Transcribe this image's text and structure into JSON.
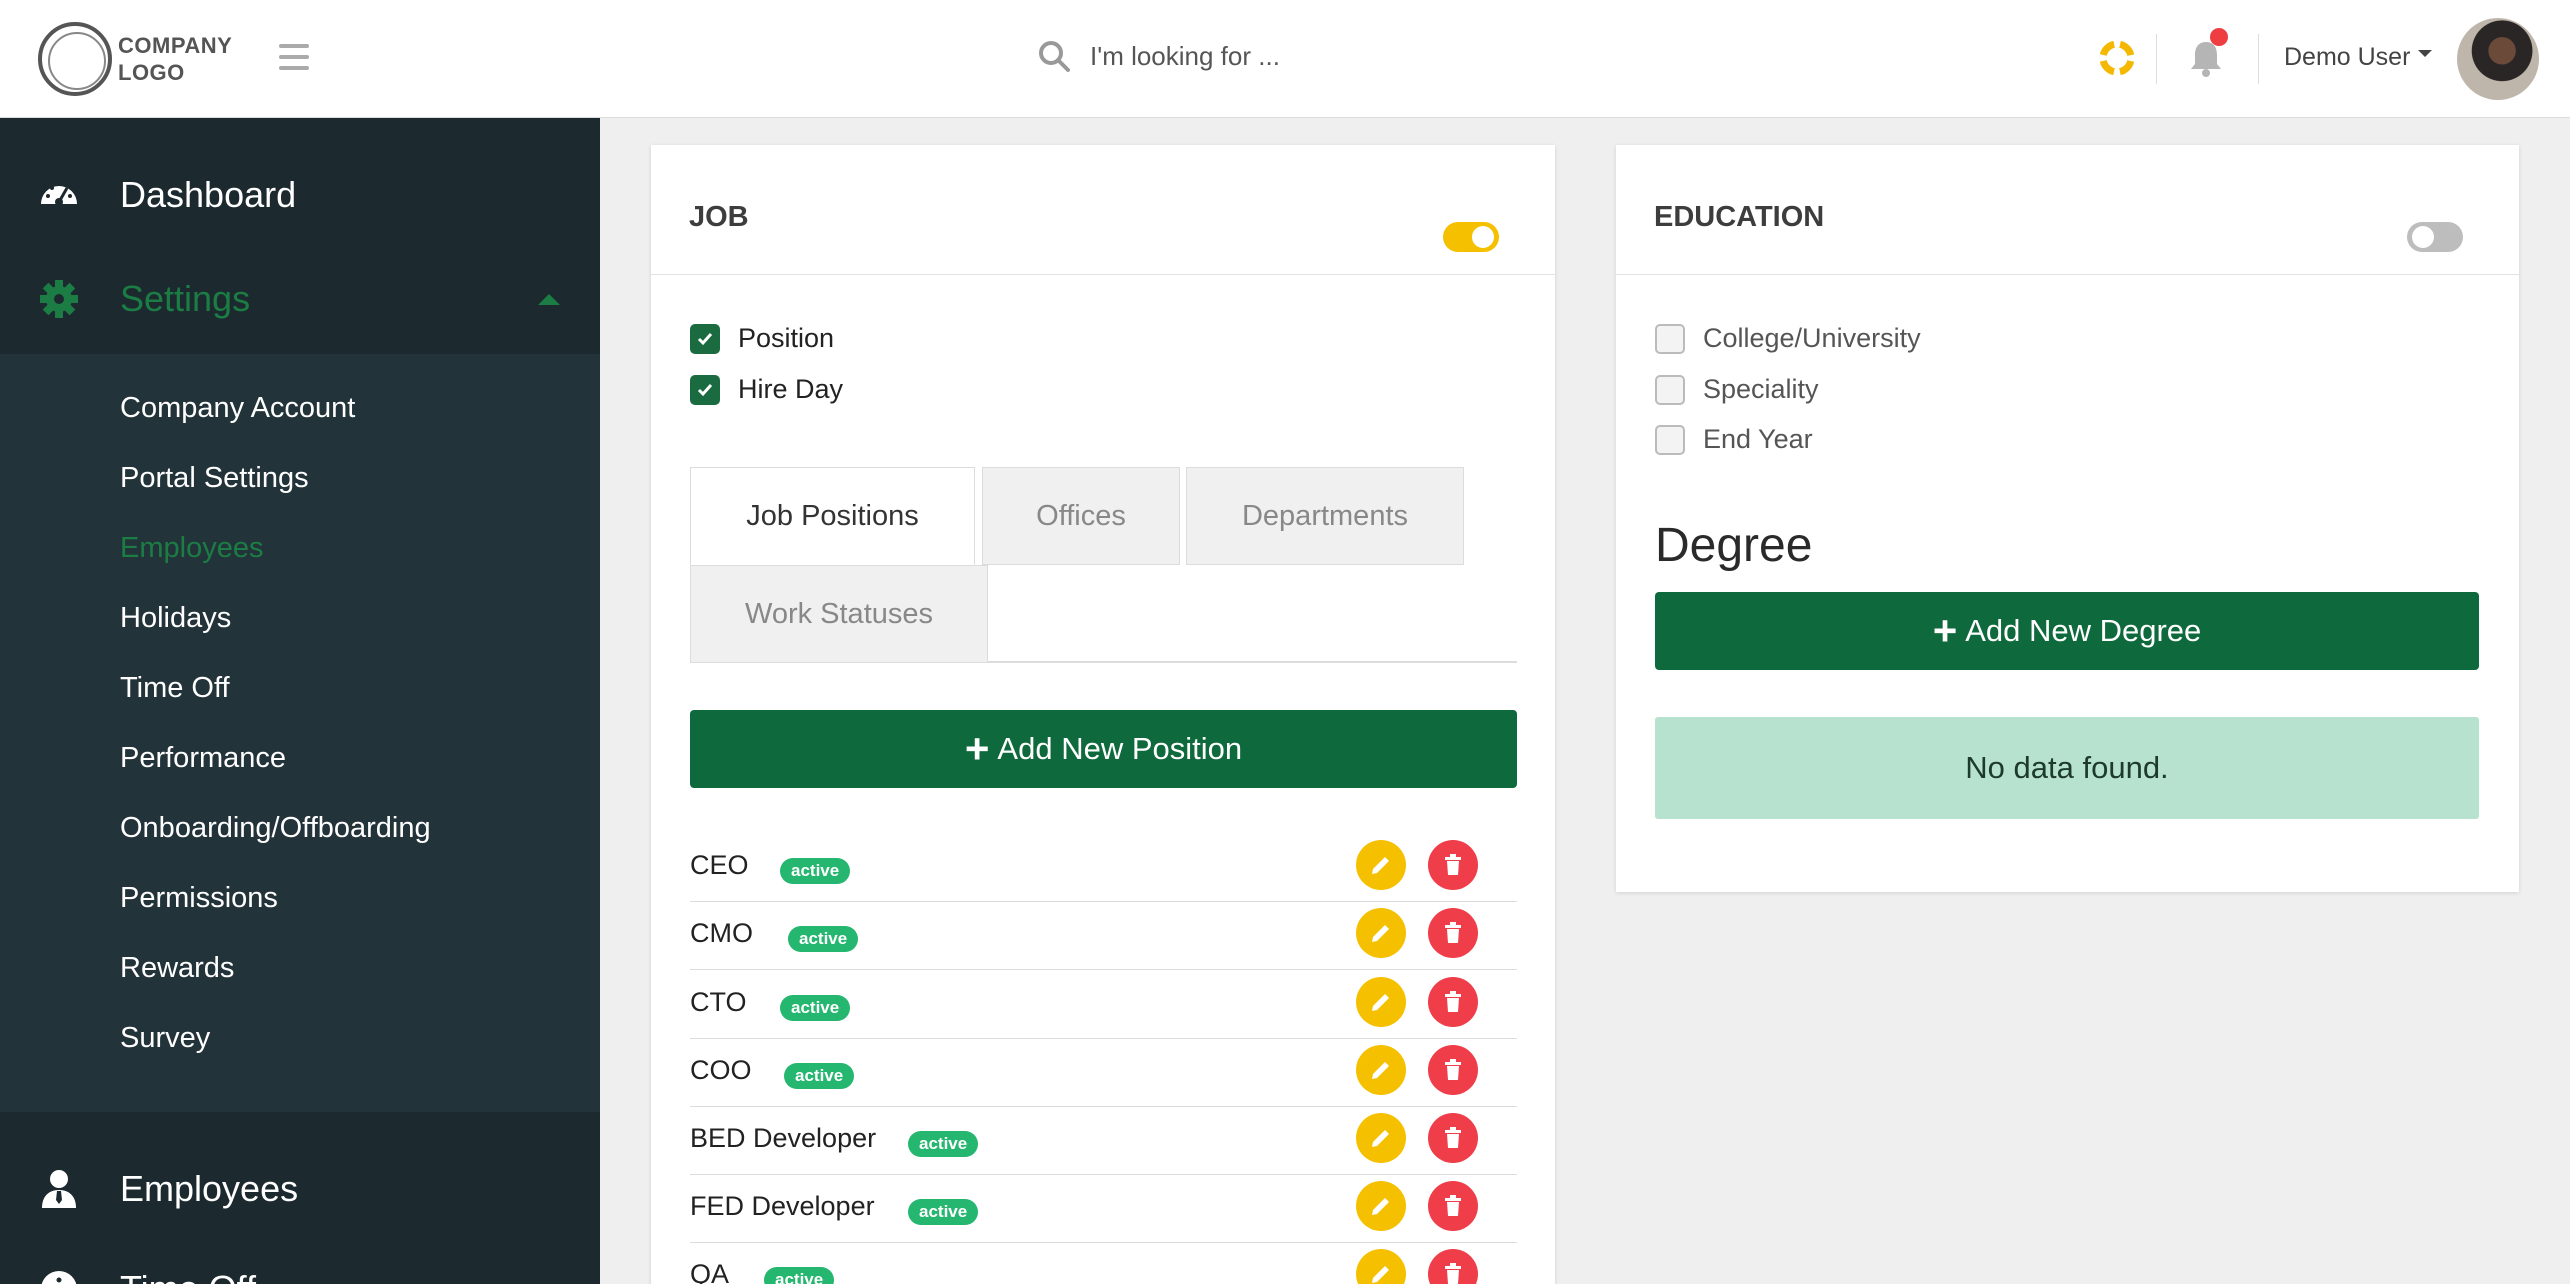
{
  "header": {
    "logo_line1": "COMPANY",
    "logo_line2": "LOGO",
    "search_placeholder": "I'm looking for ...",
    "user_name": "Demo User"
  },
  "sidebar": {
    "dashboard": "Dashboard",
    "settings": "Settings",
    "sub_items": [
      "Company Account",
      "Portal Settings",
      "Employees",
      "Holidays",
      "Time Off",
      "Performance",
      "Onboarding/Offboarding",
      "Permissions",
      "Rewards",
      "Survey"
    ],
    "active_sub_item": "Employees",
    "employees": "Employees",
    "time_off_partial": "Time Off"
  },
  "job_card": {
    "title": "JOB",
    "toggle_on": true,
    "checkboxes": [
      {
        "label": "Position",
        "checked": true
      },
      {
        "label": "Hire Day",
        "checked": true
      }
    ],
    "tabs": [
      "Job Positions",
      "Offices",
      "Departments",
      "Work Statuses"
    ],
    "active_tab": "Job Positions",
    "add_button": "Add New Position",
    "positions": [
      {
        "name": "CEO",
        "status": "active"
      },
      {
        "name": "CMO",
        "status": "active"
      },
      {
        "name": "CTO",
        "status": "active"
      },
      {
        "name": "COO",
        "status": "active"
      },
      {
        "name": "BED Developer",
        "status": "active"
      },
      {
        "name": "FED Developer",
        "status": "active"
      },
      {
        "name": "QA",
        "status": "active"
      }
    ]
  },
  "education_card": {
    "title": "EDUCATION",
    "toggle_on": false,
    "checkboxes": [
      {
        "label": "College/University",
        "checked": false
      },
      {
        "label": "Speciality",
        "checked": false
      },
      {
        "label": "End Year",
        "checked": false
      }
    ],
    "degree_heading": "Degree",
    "add_button": "Add New Degree",
    "empty_message": "No data found."
  },
  "colors": {
    "brand_green": "#0e6a3c",
    "sidebar_bg": "#23333a",
    "accent_yellow": "#f5c000",
    "danger_red": "#ef3e4a",
    "badge_green": "#25b66f"
  }
}
